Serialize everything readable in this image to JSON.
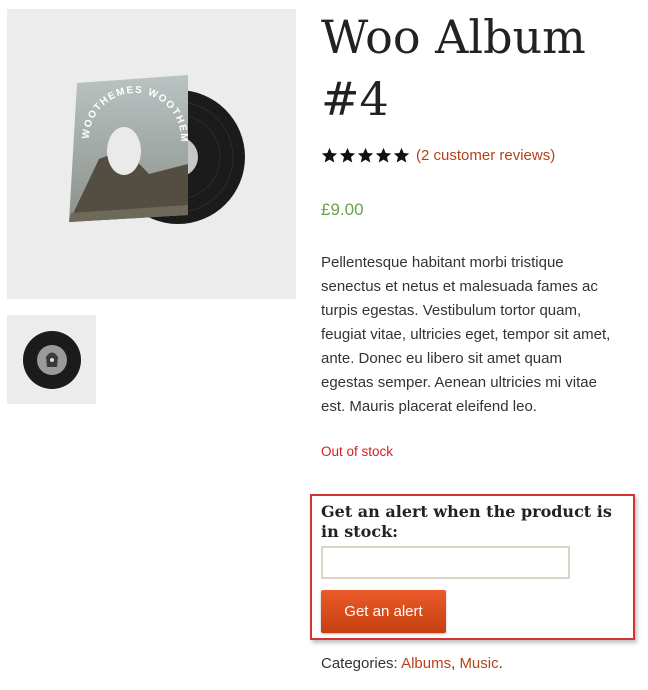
{
  "product": {
    "title": "Woo Album #4",
    "rating_stars": 5,
    "reviews_link": "(2 customer reviews)",
    "price": "£9.00",
    "description": "Pellentesque habitant morbi tristique senectus et netus et malesuada fames ac turpis egestas. Vestibulum tortor quam, feugiat vitae, ultricies eget, tempor sit amet, ante. Donec eu libero sit amet quam egestas semper. Aenean ultricies mi vitae est. Mauris placerat eleifend leo.",
    "stock_status": "Out of stock",
    "image_text": "WOOTHEMES WOOTHEMES"
  },
  "alert": {
    "heading": "Get an alert when the product is in stock:",
    "input_value": "",
    "input_placeholder": "",
    "button_label": "Get an alert"
  },
  "categories": {
    "label": "Categories:",
    "items": [
      "Albums",
      "Music"
    ],
    "separator": ",",
    "end": "."
  },
  "colors": {
    "link": "#b8401a",
    "price": "#6aa24c",
    "out_of_stock": "#d11f1f",
    "button": "#d94e1c",
    "highlight_border": "#d23434"
  }
}
